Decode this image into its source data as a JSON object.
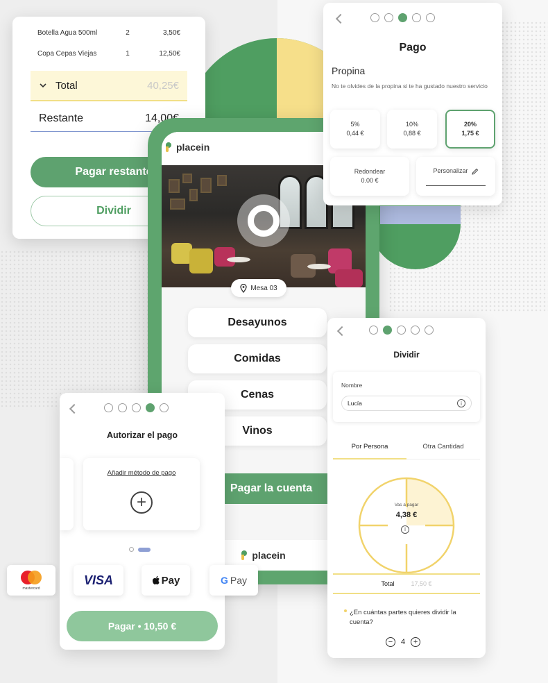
{
  "bill": {
    "items": [
      {
        "name": "Botella Agua 500ml",
        "qty": "2",
        "price": "3,50€"
      },
      {
        "name": "Copa Cepas Viejas",
        "qty": "1",
        "price": "12,50€"
      }
    ],
    "total_label": "Total",
    "total_value": "40,25€",
    "remaining_label": "Restante",
    "remaining_value": "14,00€",
    "pay_remaining": "Pagar restante",
    "split": "Dividir"
  },
  "phone": {
    "brand": "placein",
    "table": "Mesa 03",
    "menu": [
      "Desayunos",
      "Comidas",
      "Cenas",
      "Vinos"
    ],
    "pay_bill": "Pagar la cuenta",
    "footer_brand": "placein"
  },
  "pago": {
    "title": "Pago",
    "tip_label": "Propina",
    "tip_hint": "No te olvides de la propina si te ha gustado nuestro servicio",
    "tips": [
      {
        "pct": "5%",
        "amount": "0,44 €"
      },
      {
        "pct": "10%",
        "amount": "0,88 €"
      },
      {
        "pct": "20%",
        "amount": "1,75 €"
      }
    ],
    "round_label": "Redondear",
    "round_value": "0.00 €",
    "custom_label": "Personalizar"
  },
  "dividir": {
    "title": "Dividir",
    "name_label": "Nombre",
    "name_value": "Lucía",
    "tab_person": "Por Persona",
    "tab_other": "Otra Cantidad",
    "pie_caption": "Vas a pagar",
    "pie_amount": "4,38 €",
    "total_label": "Total",
    "total_value": "17,50 €",
    "question": "¿En cuántas partes quieres dividir la cuenta?",
    "count": "4"
  },
  "autorizar": {
    "title": "Autorizar el pago",
    "add_method": "Añadir método de pago",
    "pay_button": "Pagar • 10,50 €"
  },
  "payment_logos": {
    "mastercard_caption": "mastercard",
    "visa": "VISA",
    "apple_pay": "Pay",
    "google_pay": "Pay"
  },
  "colors": {
    "brand_green": "#5ea26f",
    "brand_yellow": "#f1df86",
    "accent_blue": "#8e9fd4"
  }
}
